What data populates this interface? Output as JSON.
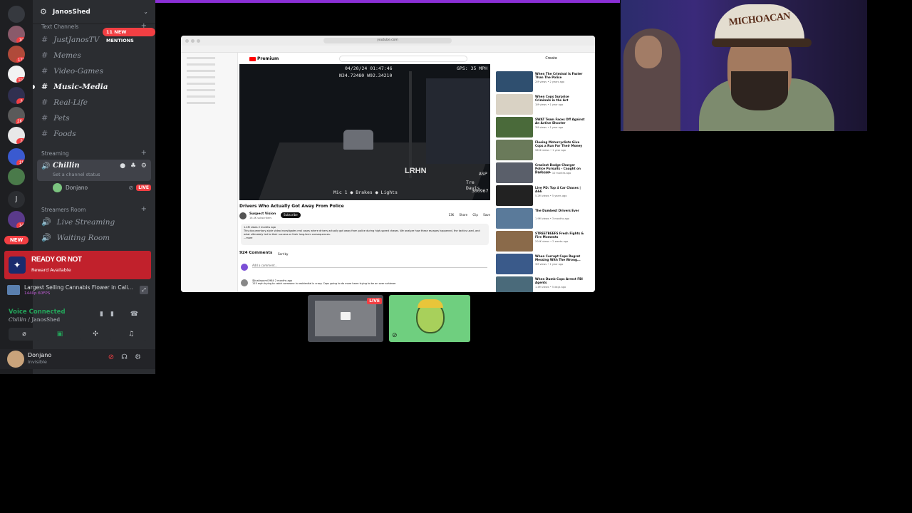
{
  "guild": {
    "name": "JanosShed"
  },
  "categories": {
    "text": "Text Channels",
    "streaming": "Streaming",
    "streamers_room": "Streamers Room"
  },
  "mentions_badge": "11 NEW MENTIONS",
  "text_channels": [
    {
      "name": "JustJanosTV"
    },
    {
      "name": "Memes"
    },
    {
      "name": "Video-Games"
    },
    {
      "name": "Music-Media"
    },
    {
      "name": "Real-Life"
    },
    {
      "name": "Pets"
    },
    {
      "name": "Foods"
    }
  ],
  "voice_channel": {
    "name": "Chillin",
    "status_placeholder": "Set a channel status",
    "user": "Donjano",
    "live": "LIVE"
  },
  "streamers_channels": [
    {
      "name": "Live Streaming"
    },
    {
      "name": "Waiting Room"
    }
  ],
  "rail": {
    "badges": [
      "10",
      "178",
      "110",
      "3",
      "2K+",
      "2",
      "",
      "11",
      "",
      "14"
    ],
    "dm_letter": "J",
    "new_label": "NEW"
  },
  "reward": {
    "title": "READY OR NOT",
    "subtitle": "Reward Available"
  },
  "promo": {
    "title": "Largest Selling Cannabis Flower in Cali...",
    "subtitle": "1440p 60FPS"
  },
  "voice_connected": {
    "title": "Voice Connected",
    "channel": "Chillin",
    "guild": "JanosShed"
  },
  "user": {
    "name": "Donjano",
    "status": "Invisible"
  },
  "browser": {
    "url": "youtube.com",
    "logo": "Premium",
    "create": "Create",
    "video_overlay": {
      "timestamp": "04/20/24 01:47:46",
      "coords": "N34.72480 W92.34210",
      "gps": "GPS: 35 MPH",
      "watermark": "LRHN",
      "agency": "ASP",
      "officer": "Tre Davis",
      "unit": "300967",
      "indicators": "Mic 1 ● Brakes ● Lights"
    },
    "video_title": "Drivers Who Actually Got Away From Police",
    "channel": "Suspect Vision",
    "subs": "16.4K subscribers",
    "subscribe": "Subscribe",
    "actions": "13K Share Clip Save",
    "description_meta": "1.4M views  2 months ago",
    "description": "This documentary-style video investigates real cases where drivers actually got away from police during high-speed chases. We analyze how these escapes happened, the tactics used, and what ultimately led to their success or their long-term consequences.",
    "more": "...more",
    "comments_count": "924 Comments",
    "sort_by": "Sort by",
    "add_comment": "Add a comment...",
    "top_comment_user": "@justinpaml1984  2 months ago",
    "top_comment": "115 mph trying to catch someone in residential is crazy. Cops going to do more harm trying to be an over achiever",
    "related": [
      {
        "title": "When The Criminal Is Faster Than The Police",
        "meta": "2M views • 2 years ago",
        "color": "#2f4f6f"
      },
      {
        "title": "When Cops Surprise Criminals in the Act",
        "meta": "1M views • 1 year ago",
        "color": "#d9d2c4"
      },
      {
        "title": "SWAT Team Faces Off Against An Active Shooter",
        "meta": "3M views • 1 year ago",
        "color": "#4a6a3a"
      },
      {
        "title": "Fleeing Motorcyclists Give Cops a Run For Their Money",
        "meta": "985K views • 1 year ago",
        "color": "#6a7a5a"
      },
      {
        "title": "Craziest Dodge Charger Police Pursuits - Caught on Dashcam",
        "meta": "2.1M views • 10 months ago",
        "color": "#5a5f6a"
      },
      {
        "title": "Live PD: Top 4 Car Chases | A&E",
        "meta": "5.2M views • 5 years ago",
        "color": "#222"
      },
      {
        "title": "The Dumbest Drivers Ever",
        "meta": "1.9M views • 3 months ago",
        "color": "#5a7a9a"
      },
      {
        "title": "STREETBEEFS Fresh Fights & Fire Moments",
        "meta": "204K views • 2 weeks ago",
        "color": "#8a6a4a"
      },
      {
        "title": "When Corrupt Cops Regret Messing With The Wrong...",
        "meta": "3M views • 1 year ago",
        "color": "#3a5a8a"
      },
      {
        "title": "When Dumb Cops Arrest FBI Agents",
        "meta": "1.4M views • 5 days ago",
        "color": "#4a6a7a"
      }
    ]
  },
  "tile": {
    "live": "LIVE"
  },
  "webcam": {
    "cap_text": "MICHOACAN"
  }
}
